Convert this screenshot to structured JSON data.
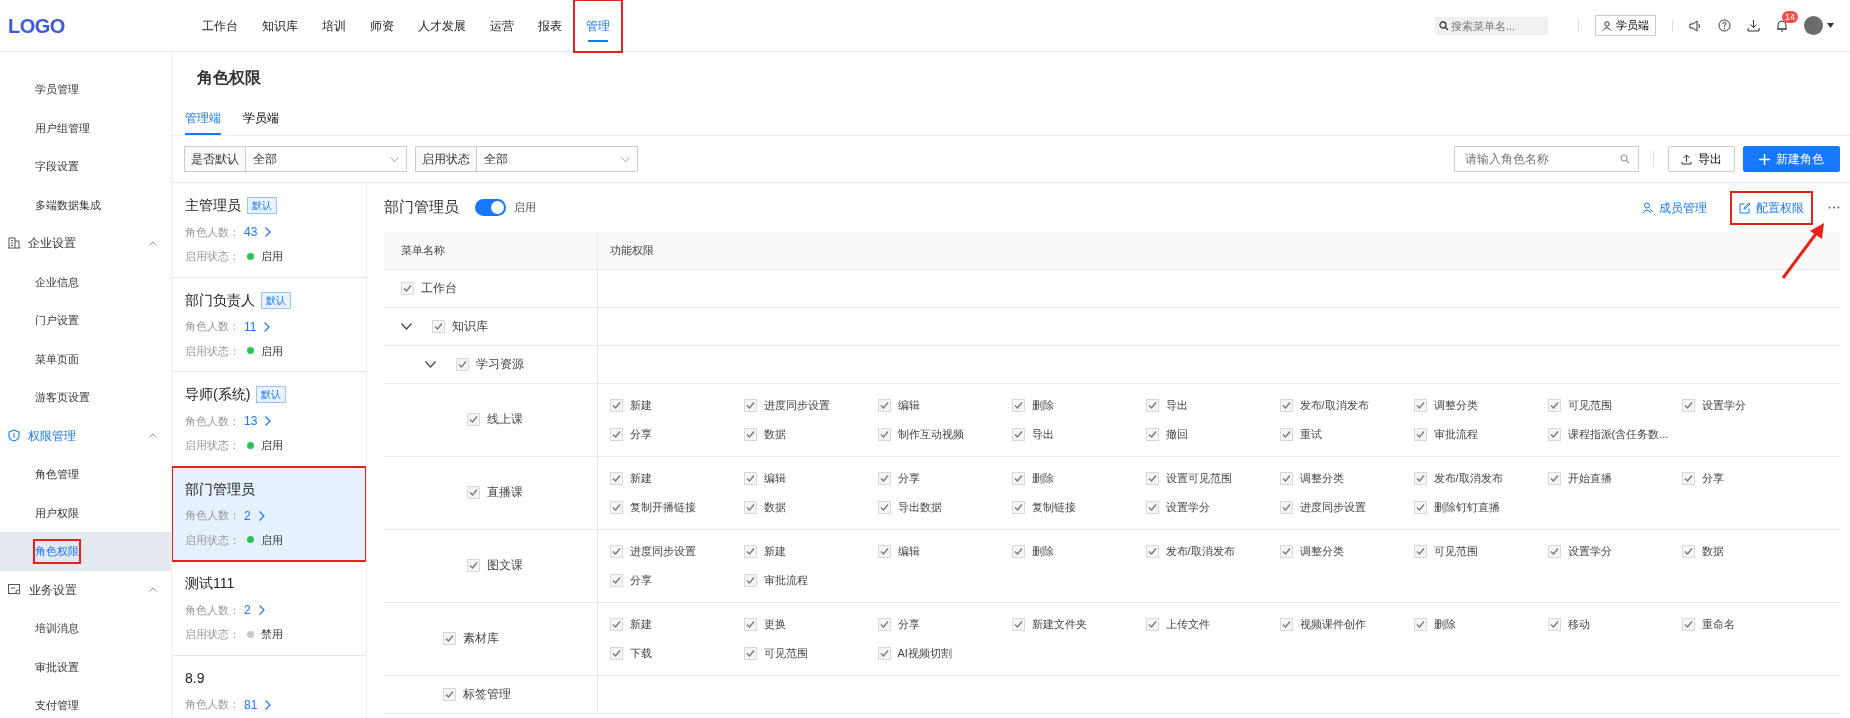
{
  "logo": "LOGO",
  "nav": [
    {
      "label": "工作台",
      "selected": false,
      "highlighted": false
    },
    {
      "label": "知识库",
      "selected": false,
      "highlighted": false
    },
    {
      "label": "培训",
      "selected": false,
      "highlighted": false
    },
    {
      "label": "师资",
      "selected": false,
      "highlighted": false
    },
    {
      "label": "人才发展",
      "selected": false,
      "highlighted": false
    },
    {
      "label": "运营",
      "selected": false,
      "highlighted": false
    },
    {
      "label": "报表",
      "selected": false,
      "highlighted": false
    },
    {
      "label": "管理",
      "selected": true,
      "highlighted": true
    }
  ],
  "header": {
    "search_placeholder": "搜索菜单名...",
    "student_button": "学员端",
    "notification_count": "14"
  },
  "sidebar": [
    {
      "items": [
        {
          "label": "学员管理",
          "selected": false,
          "highlighted": false
        },
        {
          "label": "用户组管理",
          "selected": false,
          "highlighted": false
        },
        {
          "label": "字段设置",
          "selected": false,
          "highlighted": false
        },
        {
          "label": "多端数据集成",
          "selected": false,
          "highlighted": false
        }
      ]
    },
    {
      "title": "企业设置",
      "expanded": true,
      "active": false,
      "items": [
        {
          "label": "企业信息",
          "selected": false,
          "highlighted": false
        },
        {
          "label": "门户设置",
          "selected": false,
          "highlighted": false
        },
        {
          "label": "菜单页面",
          "selected": false,
          "highlighted": false
        },
        {
          "label": "游客页设置",
          "selected": false,
          "highlighted": false
        }
      ]
    },
    {
      "title": "权限管理",
      "expanded": true,
      "active": true,
      "items": [
        {
          "label": "角色管理",
          "selected": false,
          "highlighted": false
        },
        {
          "label": "用户权限",
          "selected": false,
          "highlighted": false
        },
        {
          "label": "角色权限",
          "selected": true,
          "highlighted": true
        }
      ]
    },
    {
      "title": "业务设置",
      "expanded": true,
      "active": false,
      "items": [
        {
          "label": "培训消息",
          "selected": false,
          "highlighted": false
        },
        {
          "label": "审批设置",
          "selected": false,
          "highlighted": false
        },
        {
          "label": "支付管理",
          "selected": false,
          "highlighted": false
        }
      ]
    }
  ],
  "page_title": "角色权限",
  "tabs": [
    {
      "label": "管理端",
      "selected": true
    },
    {
      "label": "学员端",
      "selected": false
    }
  ],
  "filters": [
    {
      "label": "是否默认",
      "value": "全部"
    },
    {
      "label": "启用状态",
      "value": "全部"
    }
  ],
  "role_search": {
    "placeholder": "请输入角色名称"
  },
  "toolbar_buttons": [
    {
      "kind": "export",
      "label": "导出"
    },
    {
      "kind": "create",
      "label": "新建角色"
    }
  ],
  "roles": [
    {
      "name": "主管理员",
      "badge": "默认",
      "count_label": "角色人数：",
      "count": "43",
      "status_label": "启用状态：",
      "status": "启用",
      "enabled": true,
      "selected": false,
      "highlighted": false
    },
    {
      "name": "部门负责人",
      "badge": "默认",
      "count_label": "角色人数：",
      "count": "11",
      "status_label": "启用状态：",
      "status": "启用",
      "enabled": true,
      "selected": false,
      "highlighted": false
    },
    {
      "name": "导师(系统)",
      "badge": "默认",
      "count_label": "角色人数：",
      "count": "13",
      "status_label": "启用状态：",
      "status": "启用",
      "enabled": true,
      "selected": false,
      "highlighted": false
    },
    {
      "name": "部门管理员",
      "count_label": "角色人数：",
      "count": "2",
      "status_label": "启用状态：",
      "status": "启用",
      "enabled": true,
      "selected": true,
      "highlighted": true
    },
    {
      "name": "测试111",
      "count_label": "角色人数：",
      "count": "2",
      "status_label": "启用状态：",
      "status": "禁用",
      "enabled": false,
      "selected": false,
      "highlighted": false
    },
    {
      "name": "8.9",
      "count_label": "角色人数：",
      "count": "81",
      "selected": false,
      "highlighted": false
    }
  ],
  "detail": {
    "title": "部门管理员",
    "enabled": true,
    "toggle_label": "启用",
    "actions": [
      {
        "kind": "members",
        "label": "成员管理",
        "highlighted": false
      },
      {
        "kind": "configure",
        "label": "配置权限",
        "highlighted": true
      }
    ]
  },
  "table": {
    "columns": [
      "菜单名称",
      "功能权限"
    ],
    "disabled": true,
    "rows": [
      {
        "label": "工作台",
        "checked": true
      },
      {
        "label": "知识库",
        "checked": true,
        "expanded": true,
        "children": [
          {
            "label": "学习资源",
            "checked": true,
            "expanded": true,
            "children": [
              {
                "label": "线上课",
                "checked": true,
                "permissions": [
                  {
                    "label": "新建",
                    "checked": true
                  },
                  {
                    "label": "进度同步设置",
                    "checked": true
                  },
                  {
                    "label": "编辑",
                    "checked": true
                  },
                  {
                    "label": "删除",
                    "checked": true
                  },
                  {
                    "label": "导出",
                    "checked": true
                  },
                  {
                    "label": "发布/取消发布",
                    "checked": true
                  },
                  {
                    "label": "调整分类",
                    "checked": true
                  },
                  {
                    "label": "可见范围",
                    "checked": true
                  },
                  {
                    "label": "设置学分",
                    "checked": true
                  },
                  {
                    "label": "分享",
                    "checked": true
                  },
                  {
                    "label": "数据",
                    "checked": true
                  },
                  {
                    "label": "制作互动视频",
                    "checked": true
                  },
                  {
                    "label": "导出",
                    "checked": true
                  },
                  {
                    "label": "撤回",
                    "checked": true
                  },
                  {
                    "label": "重试",
                    "checked": true
                  },
                  {
                    "label": "审批流程",
                    "checked": true
                  },
                  {
                    "label": "课程指派(含任务数...",
                    "checked": true
                  }
                ]
              },
              {
                "label": "直播课",
                "checked": true,
                "permissions": [
                  {
                    "label": "新建",
                    "checked": true
                  },
                  {
                    "label": "编辑",
                    "checked": true
                  },
                  {
                    "label": "分享",
                    "checked": true
                  },
                  {
                    "label": "删除",
                    "checked": true
                  },
                  {
                    "label": "设置可见范围",
                    "checked": true
                  },
                  {
                    "label": "调整分类",
                    "checked": true
                  },
                  {
                    "label": "发布/取消发布",
                    "checked": true
                  },
                  {
                    "label": "开始直播",
                    "checked": true
                  },
                  {
                    "label": "分享",
                    "checked": true
                  },
                  {
                    "label": "复制开播链接",
                    "checked": true
                  },
                  {
                    "label": "数据",
                    "checked": true
                  },
                  {
                    "label": "导出数据",
                    "checked": true
                  },
                  {
                    "label": "复制链接",
                    "checked": true
                  },
                  {
                    "label": "设置学分",
                    "checked": true
                  },
                  {
                    "label": "进度同步设置",
                    "checked": true
                  },
                  {
                    "label": "删除钉钉直播",
                    "checked": true
                  }
                ]
              },
              {
                "label": "图文课",
                "checked": true,
                "permissions": [
                  {
                    "label": "进度同步设置",
                    "checked": true
                  },
                  {
                    "label": "新建",
                    "checked": true
                  },
                  {
                    "label": "编辑",
                    "checked": true
                  },
                  {
                    "label": "删除",
                    "checked": true
                  },
                  {
                    "label": "发布/取消发布",
                    "checked": true
                  },
                  {
                    "label": "调整分类",
                    "checked": true
                  },
                  {
                    "label": "可见范围",
                    "checked": true
                  },
                  {
                    "label": "设置学分",
                    "checked": true
                  },
                  {
                    "label": "数据",
                    "checked": true
                  },
                  {
                    "label": "分享",
                    "checked": true
                  },
                  {
                    "label": "审批流程",
                    "checked": true
                  }
                ]
              }
            ]
          },
          {
            "label": "素材库",
            "checked": true,
            "permissions": [
              {
                "label": "新建",
                "checked": true
              },
              {
                "label": "更换",
                "checked": true
              },
              {
                "label": "分享",
                "checked": true
              },
              {
                "label": "新建文件夹",
                "checked": true
              },
              {
                "label": "上传文件",
                "checked": true
              },
              {
                "label": "视频课件创作",
                "checked": true
              },
              {
                "label": "删除",
                "checked": true
              },
              {
                "label": "移动",
                "checked": true
              },
              {
                "label": "重命名",
                "checked": true
              },
              {
                "label": "下载",
                "checked": true
              },
              {
                "label": "可见范围",
                "checked": true
              },
              {
                "label": "AI视频切割",
                "checked": true
              }
            ]
          },
          {
            "label": "标签管理",
            "checked": true
          }
        ]
      }
    ]
  }
}
